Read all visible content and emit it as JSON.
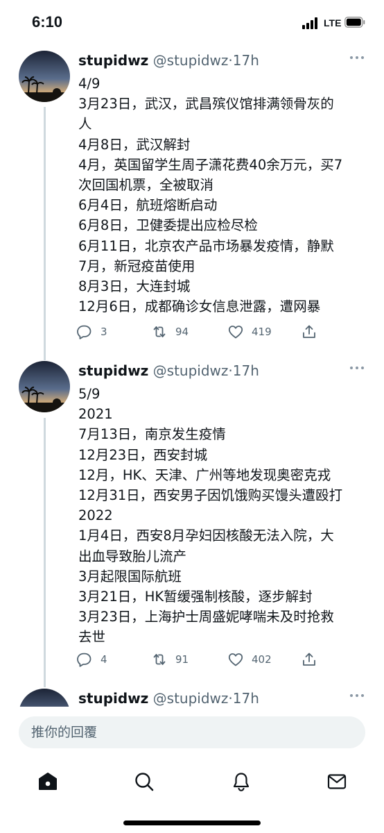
{
  "status_bar": {
    "time": "6:10",
    "network": "LTE"
  },
  "tweets": [
    {
      "name": "stupidwz",
      "handle": "@stupidwz",
      "sep": "·",
      "time": "17h",
      "lines": [
        "4/9",
        "3月23日，武汉，武昌殡仪馆排满领骨灰的",
        "人",
        "4月8日，武汉解封",
        "4月，英国留学生周子潇花费40余万元，买7",
        "次回国机票，全被取消",
        "6月4日，航班熔断启动",
        "6月8日，卫健委提出应检尽检",
        "6月11日，北京农产品市场暴发疫情，静默",
        "7月，新冠疫苗使用",
        "8月3日，大连封城",
        "12月6日，成都确诊女信息泄露，遭网暴"
      ],
      "replies": "3",
      "retweets": "94",
      "likes": "419"
    },
    {
      "name": "stupidwz",
      "handle": "@stupidwz",
      "sep": "·",
      "time": "17h",
      "lines": [
        "5/9",
        "2021",
        "7月13日，南京发生疫情",
        "12月23日，西安封城",
        "12月，HK、天津、广州等地发现奥密克戎",
        "12月31日，西安男子因饥饿购买馒头遭殴打",
        "2022",
        "1月4日，西安8月孕妇因核酸无法入院，大",
        "出血导致胎儿流产",
        "3月起限国际航班",
        "3月21日，HK暂缓强制核酸，逐步解封",
        "3月23日，上海护士周盛妮哮喘未及时抢救",
        "去世"
      ],
      "replies": "4",
      "retweets": "91",
      "likes": "402"
    },
    {
      "name": "stupidwz",
      "handle": "@stupidwz",
      "sep": "·",
      "time": "17h"
    }
  ],
  "reply": {
    "placeholder": "推你的回覆"
  },
  "icons": {
    "more": "more-icon",
    "reply": "reply-icon",
    "retweet": "retweet-icon",
    "like": "heart-icon",
    "share": "share-icon",
    "nav": [
      "home-icon",
      "search-icon",
      "notifications-icon",
      "messages-icon"
    ]
  },
  "colors": {
    "text": "#0f1419",
    "secondary": "#536471",
    "thread_line": "#cfd9de",
    "input_bg": "#eff3f4"
  }
}
